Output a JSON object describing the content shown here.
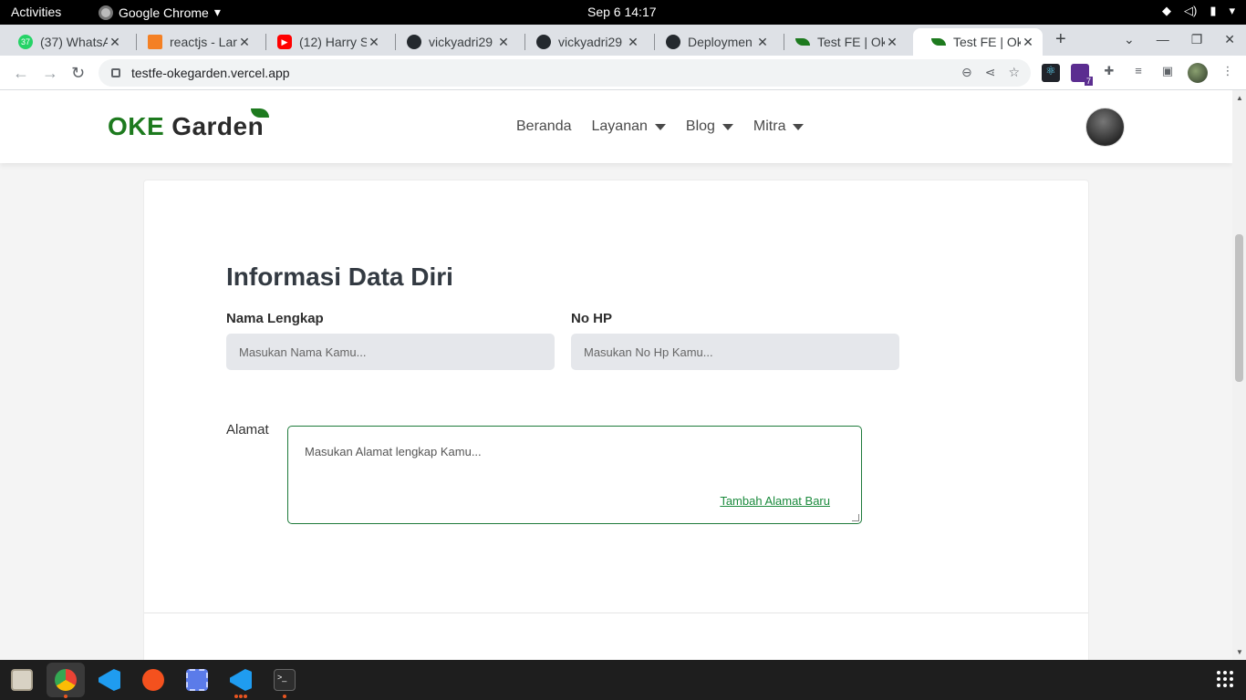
{
  "system": {
    "activities": "Activities",
    "app_name": "Google Chrome",
    "clock": "Sep 6  14:17"
  },
  "tabs": [
    {
      "title": "(37) WhatsA",
      "icon": "whatsapp-icon",
      "badge": "37",
      "color": "#25d366"
    },
    {
      "title": "reactjs - Lar",
      "icon": "stackoverflow-icon",
      "color": "#f48024"
    },
    {
      "title": "(12) Harry S",
      "icon": "youtube-icon",
      "color": "#ff0000"
    },
    {
      "title": "vickyadri29",
      "icon": "github-icon",
      "color": "#24292e"
    },
    {
      "title": "vickyadri29",
      "icon": "github-icon",
      "color": "#24292e"
    },
    {
      "title": "Deploymen",
      "icon": "github-icon",
      "color": "#24292e"
    },
    {
      "title": "Test FE | Ok",
      "icon": "leaf-icon",
      "color": "#1d7a1e"
    },
    {
      "title": "Test FE | Ok",
      "icon": "leaf-icon",
      "color": "#1d7a1e",
      "active": true
    }
  ],
  "address_bar": {
    "url": "testfe-okegarden.vercel.app"
  },
  "extensions": {
    "badge_count": "7"
  },
  "site": {
    "logo_primary": "OKE",
    "logo_secondary": "Garden",
    "nav": {
      "home": "Beranda",
      "services": "Layanan",
      "blog": "Blog",
      "partner": "Mitra"
    }
  },
  "form": {
    "title": "Informasi Data Diri",
    "name_label": "Nama Lengkap",
    "name_placeholder": "Masukan Nama Kamu...",
    "phone_label": "No HP",
    "phone_placeholder": "Masukan No Hp Kamu...",
    "address_label": "Alamat",
    "address_placeholder": "Masukan Alamat lengkap Kamu...",
    "add_address_link": "Tambah Alamat Baru"
  },
  "colors": {
    "brand_green": "#1d7a1e",
    "link_green": "#1a8a3c",
    "input_bg": "#e5e7eb"
  }
}
